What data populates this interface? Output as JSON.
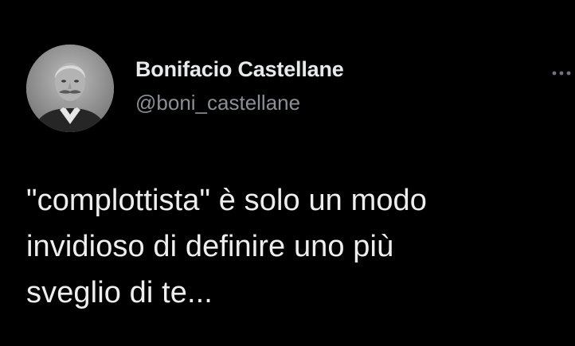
{
  "author": {
    "display_name": "Bonifacio Castellane",
    "handle": "@boni_castellane",
    "avatar_icon": "profile-photo"
  },
  "tweet": {
    "text": "\"complottista\" è solo un modo\ninvidioso di definire uno più\nsveglio di te..."
  },
  "menu": {
    "icon": "more-options-icon"
  },
  "colors": {
    "background": "#000000",
    "name": "#e7e9ea",
    "handle": "#8b8f93",
    "text": "#eeeeee"
  }
}
